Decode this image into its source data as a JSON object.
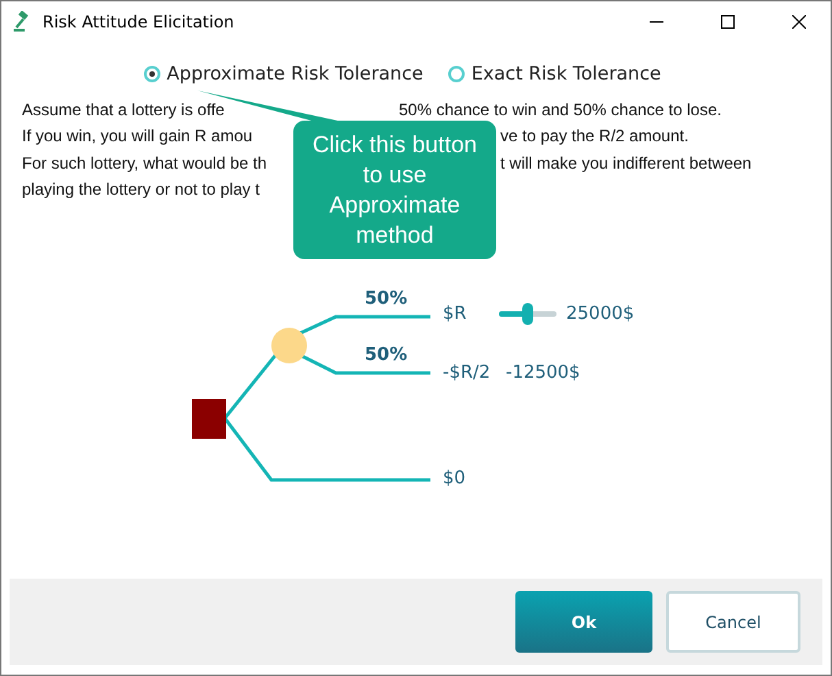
{
  "window": {
    "title": "Risk Attitude Elicitation"
  },
  "methods": [
    {
      "label": "Approximate Risk Tolerance",
      "selected": true
    },
    {
      "label": "Exact Risk Tolerance",
      "selected": false
    }
  ],
  "description_lines": [
    {
      "left": "Assume that a lottery is offe",
      "right": "50% chance to win and 50% chance to lose."
    },
    {
      "left": "If you win, you will gain R amou",
      "right": "ve to pay the R/2 amount."
    },
    {
      "left": "For such lottery, what would be th",
      "right": "t will make you indifferent between"
    },
    {
      "left": "playing the lottery or not to play t"
    }
  ],
  "callout": {
    "text": "Click this button to use Approximate method"
  },
  "tree": {
    "outcomes": [
      {
        "probability": "50%",
        "label": "$R",
        "kind": "slider",
        "level": 0.5,
        "value": "25000$"
      },
      {
        "probability": "50%",
        "label": "-$R/2",
        "kind": "value",
        "value": "-12500$"
      },
      {
        "label": "$0",
        "kind": "plain"
      }
    ]
  },
  "buttons": [
    {
      "label": "Ok",
      "kind": "primary"
    },
    {
      "label": "Cancel",
      "kind": "secondary"
    }
  ]
}
